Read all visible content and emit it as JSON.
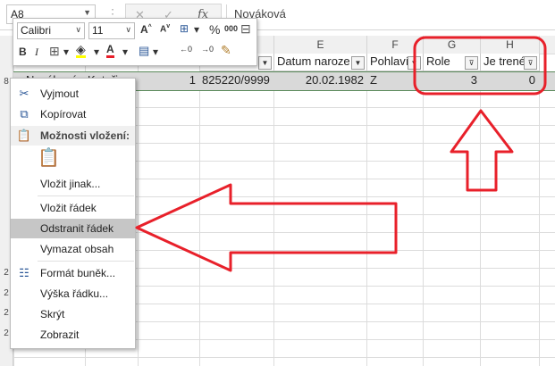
{
  "formula_bar": {
    "namebox": "A8",
    "fx_label": "fx",
    "value": "Nováková"
  },
  "mini_toolbar": {
    "font_name": "Calibri",
    "font_size": "11",
    "percent": "%",
    "thousands": "000"
  },
  "columns": [
    {
      "letter": "E"
    },
    {
      "letter": "F"
    },
    {
      "letter": "G"
    },
    {
      "letter": "H"
    }
  ],
  "header_row": {
    "datum": "Datum naroze",
    "pohlavi": "Pohlaví",
    "role": "Role",
    "je_trener": "Je trenér"
  },
  "data_row": {
    "prijmeni": "Nováková",
    "jmeno": "Kateřina",
    "poradi": "1",
    "rodne_cislo": "825220/9999",
    "datum": "20.02.1982",
    "pohlavi": "Z",
    "role": "3",
    "je_trener": "0"
  },
  "row_numbers": [
    "8",
    "2",
    "2",
    "2",
    "2"
  ],
  "context_menu": {
    "cut": "Vyjmout",
    "copy": "Kopírovat",
    "paste_options": "Možnosti vložení:",
    "paste_special": "Vložit jinak...",
    "insert_row": "Vložit řádek",
    "delete_row": "Odstranit řádek",
    "clear_contents": "Vymazat obsah",
    "format_cells": "Formát buněk...",
    "row_height": "Výška řádku...",
    "hide": "Skrýt",
    "unhide": "Zobrazit"
  },
  "colors": {
    "annotation_red": "#e8202a",
    "highlight": "#c6c6c6",
    "selected_row": "#d9d9d9"
  }
}
